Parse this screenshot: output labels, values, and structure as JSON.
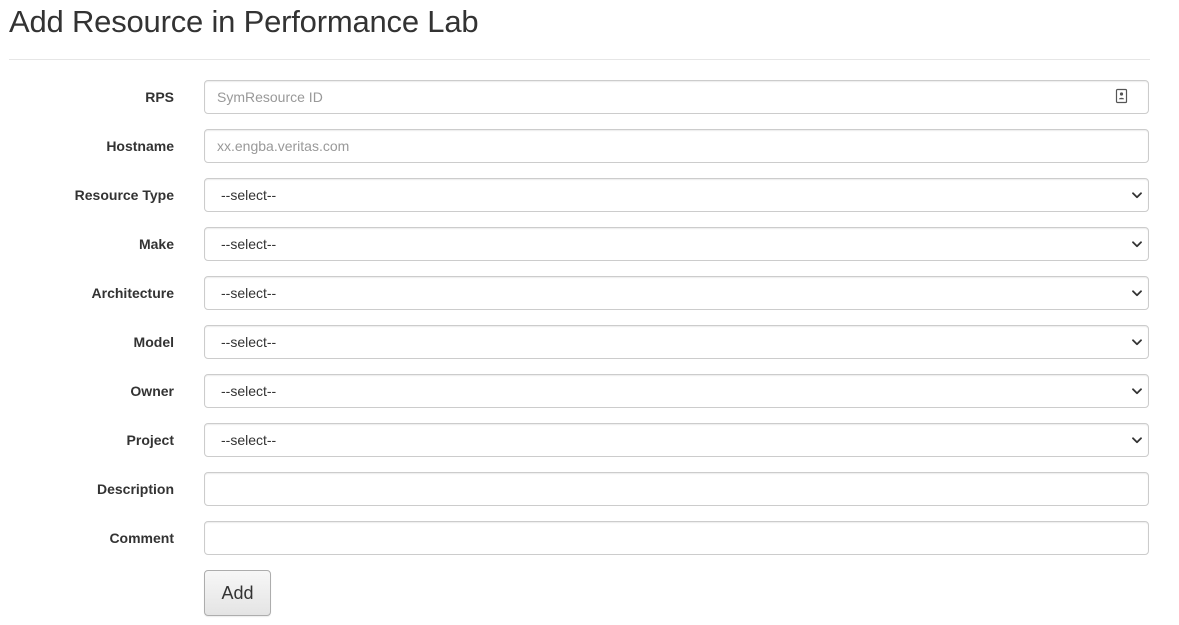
{
  "page": {
    "title": "Add Resource in Performance Lab"
  },
  "form": {
    "rps": {
      "label": "RPS",
      "placeholder": "SymResource ID",
      "value": "",
      "icon": "contact-card-icon"
    },
    "hostname": {
      "label": "Hostname",
      "placeholder": "xx.engba.veritas.com",
      "value": ""
    },
    "resource_type": {
      "label": "Resource Type",
      "selected": "--select--"
    },
    "make": {
      "label": "Make",
      "selected": "--select--"
    },
    "architecture": {
      "label": "Architecture",
      "selected": "--select--"
    },
    "model": {
      "label": "Model",
      "selected": "--select--"
    },
    "owner": {
      "label": "Owner",
      "selected": "--select--"
    },
    "project": {
      "label": "Project",
      "selected": "--select--"
    },
    "description": {
      "label": "Description",
      "value": ""
    },
    "comment": {
      "label": "Comment",
      "value": ""
    },
    "submit_label": "Add"
  },
  "colors": {
    "text": "#333333",
    "border": "#cccccc",
    "divider": "#e6e6e6",
    "placeholder": "#999999"
  }
}
